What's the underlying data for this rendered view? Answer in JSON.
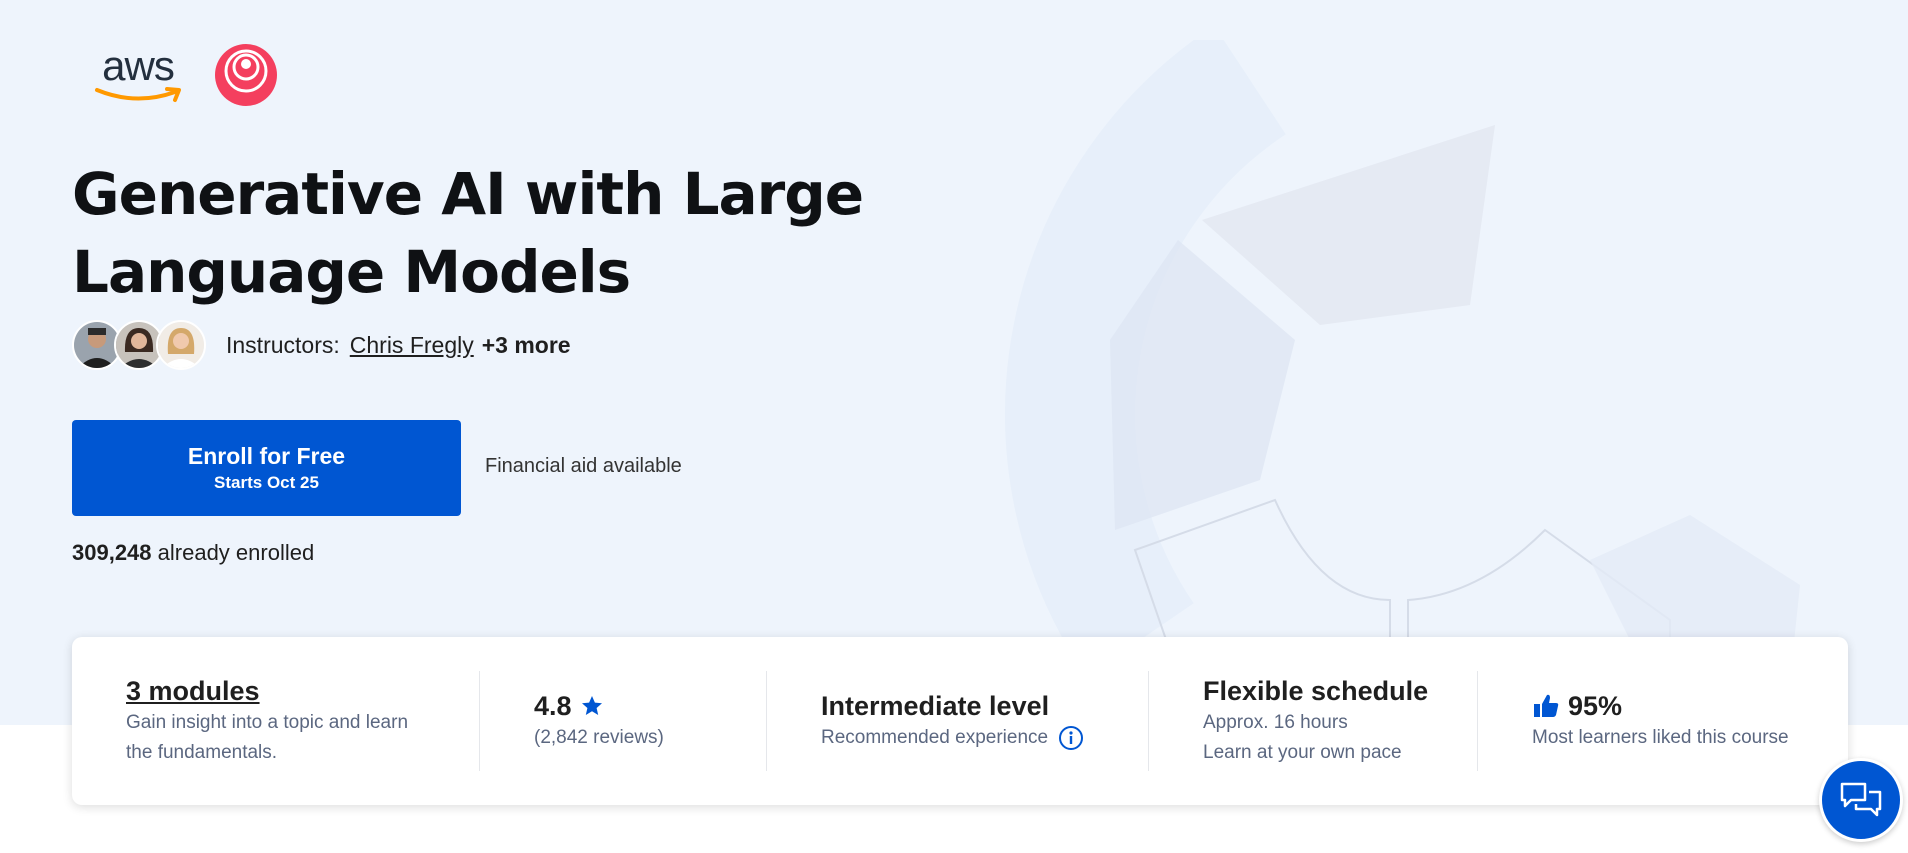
{
  "colors": {
    "hero_background": "#eef4fc",
    "primary": "#0056d2",
    "secondary_text": "#5b6780",
    "accent_logo": "#f43f5e"
  },
  "logos": {
    "aws_text": "aws",
    "partner_icon": "deeplearning-ai-logo-icon"
  },
  "course": {
    "title": "Generative AI with Large Language Models"
  },
  "instructors": {
    "label": "Instructors:",
    "primary_name": "Chris Fregly",
    "more": "+3 more",
    "avatars": [
      "avatar-1",
      "avatar-2",
      "avatar-3"
    ]
  },
  "enroll": {
    "label": "Enroll for Free",
    "sublabel": "Starts Oct 25",
    "financial_aid": "Financial aid available",
    "count": "309,248",
    "count_suffix": "already enrolled"
  },
  "info": {
    "modules": {
      "title": "3 modules",
      "line1": "Gain insight into a topic and learn",
      "line2": "the fundamentals."
    },
    "rating": {
      "value": "4.8",
      "reviews": "(2,842 reviews)",
      "icon": "star-icon"
    },
    "level": {
      "title": "Intermediate level",
      "subtitle": "Recommended experience",
      "icon": "info-icon"
    },
    "schedule": {
      "title": "Flexible schedule",
      "line1": "Approx. 16 hours",
      "line2": "Learn at your own pace"
    },
    "liked": {
      "value": "95%",
      "subtitle": "Most learners liked this course",
      "icon": "thumbs-up-icon"
    }
  },
  "chat": {
    "icon": "chat-icon"
  }
}
